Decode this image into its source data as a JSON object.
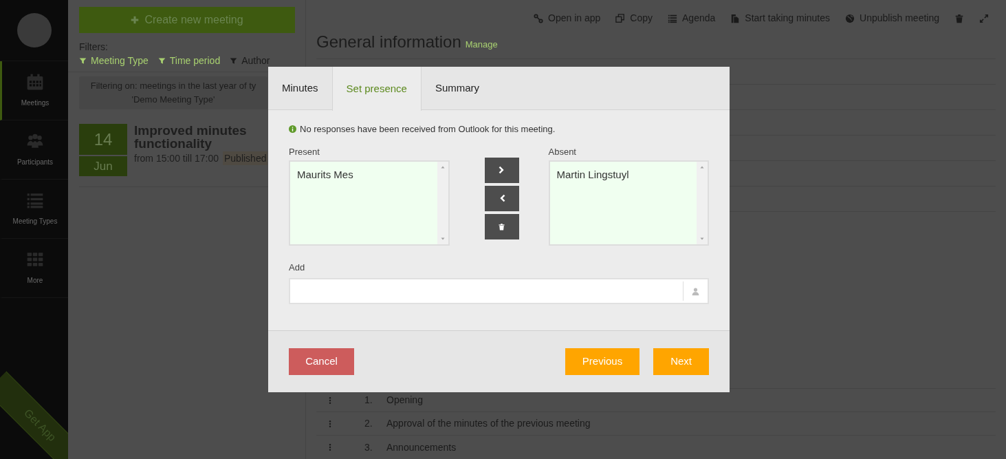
{
  "sidebar": {
    "items": [
      {
        "label": "Meetings",
        "kind": "calendar",
        "selected": true
      },
      {
        "label": "Participants",
        "kind": "people",
        "selected": false
      },
      {
        "label": "Meeting Types",
        "kind": "list",
        "selected": false
      },
      {
        "label": "More",
        "kind": "grid",
        "selected": false
      }
    ],
    "get_app": "Get App"
  },
  "meetings_panel": {
    "create_button": "Create new meeting",
    "filters_label": "Filters:",
    "filters": [
      {
        "label": "Meeting Type",
        "active": true
      },
      {
        "label": "Time period",
        "active": true
      },
      {
        "label": "Author",
        "active": false
      }
    ],
    "filter_summary": [
      "Filtering on: meetings in the last year of ty",
      "'Demo Meeting Type'"
    ],
    "meetings": [
      {
        "day": "14",
        "month": "Jun",
        "title": "Improved minutes functionality",
        "time": "from 15:00 till 17:00",
        "status": "Published"
      }
    ]
  },
  "detail": {
    "toolbar": [
      {
        "kind": "link",
        "label": "Open in app"
      },
      {
        "kind": "copy",
        "label": "Copy"
      },
      {
        "kind": "list",
        "label": "Agenda"
      },
      {
        "kind": "document",
        "label": "Start taking minutes"
      },
      {
        "kind": "globe",
        "label": "Unpublish meeting"
      },
      {
        "kind": "trash"
      },
      {
        "kind": "expand"
      }
    ],
    "title": "General information",
    "manage": "Manage",
    "agenda": [
      {
        "number": "1.",
        "title": "Opening"
      },
      {
        "number": "2.",
        "title": "Approval of the minutes of the previous meeting"
      },
      {
        "number": "3.",
        "title": "Announcements"
      }
    ]
  },
  "dialog": {
    "tabs": [
      {
        "label": "Minutes",
        "selected": false
      },
      {
        "label": "Set presence",
        "selected": true
      },
      {
        "label": "Summary",
        "selected": false
      }
    ],
    "notice": "No responses have been received from Outlook for this meeting.",
    "present": {
      "label": "Present",
      "items": [
        "Maurits Mes"
      ]
    },
    "absent": {
      "label": "Absent",
      "items": [
        "Martin Lingstuyl"
      ]
    },
    "move_buttons": [
      {
        "kind": "right"
      },
      {
        "kind": "left"
      },
      {
        "kind": "delete"
      }
    ],
    "add": {
      "label": "Add"
    },
    "buttons": [
      {
        "label": "Cancel",
        "kind": "danger"
      },
      {
        "label": "Previous",
        "kind": "primary"
      },
      {
        "label": "Next",
        "kind": "primary"
      }
    ]
  }
}
